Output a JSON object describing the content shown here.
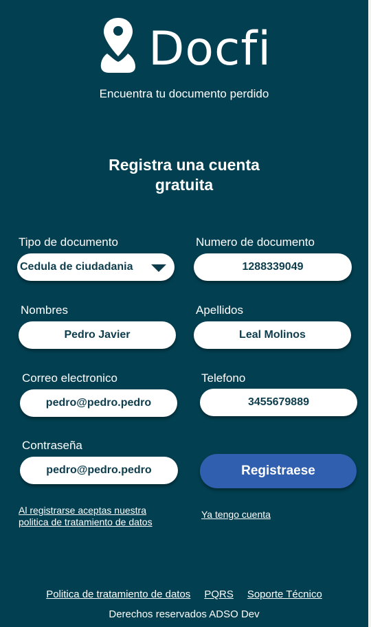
{
  "brand": {
    "name": "Docfi",
    "tagline": "Encuentra tu documento perdido"
  },
  "heading": {
    "line1": "Registra una cuenta",
    "line2": "gratuita"
  },
  "form": {
    "doc_type": {
      "label": "Tipo de documento",
      "value": "Cedula de ciudadania"
    },
    "doc_number": {
      "label": "Numero de documento",
      "value": "1288339049"
    },
    "names": {
      "label": "Nombres",
      "value": "Pedro Javier"
    },
    "surnames": {
      "label": "Apellidos",
      "value": "Leal Molinos"
    },
    "email": {
      "label": "Correo electronico",
      "value": "pedro@pedro.pedro"
    },
    "phone": {
      "label": "Telefono",
      "value": "3455679889"
    },
    "password": {
      "label": "Contraseña",
      "value": "pedro@pedro.pedro"
    },
    "submit_label": "Registraese",
    "policy_line1": "Al registrarse aceptas nuestra",
    "policy_line2": "politica de tratamiento de datos",
    "login_link": "Ya tengo cuenta"
  },
  "footer": {
    "links": [
      "Politica de tratamiento de datos",
      "PQRS",
      "Soporte Técnico"
    ],
    "copyright": "Derechos reservados ADSO Dev"
  },
  "colors": {
    "background": "#023f50",
    "button": "#2f5fae",
    "field_text": "#0d3d4d"
  },
  "icons": {
    "logo": "location-person-icon",
    "dropdown": "chevron-down-icon"
  }
}
